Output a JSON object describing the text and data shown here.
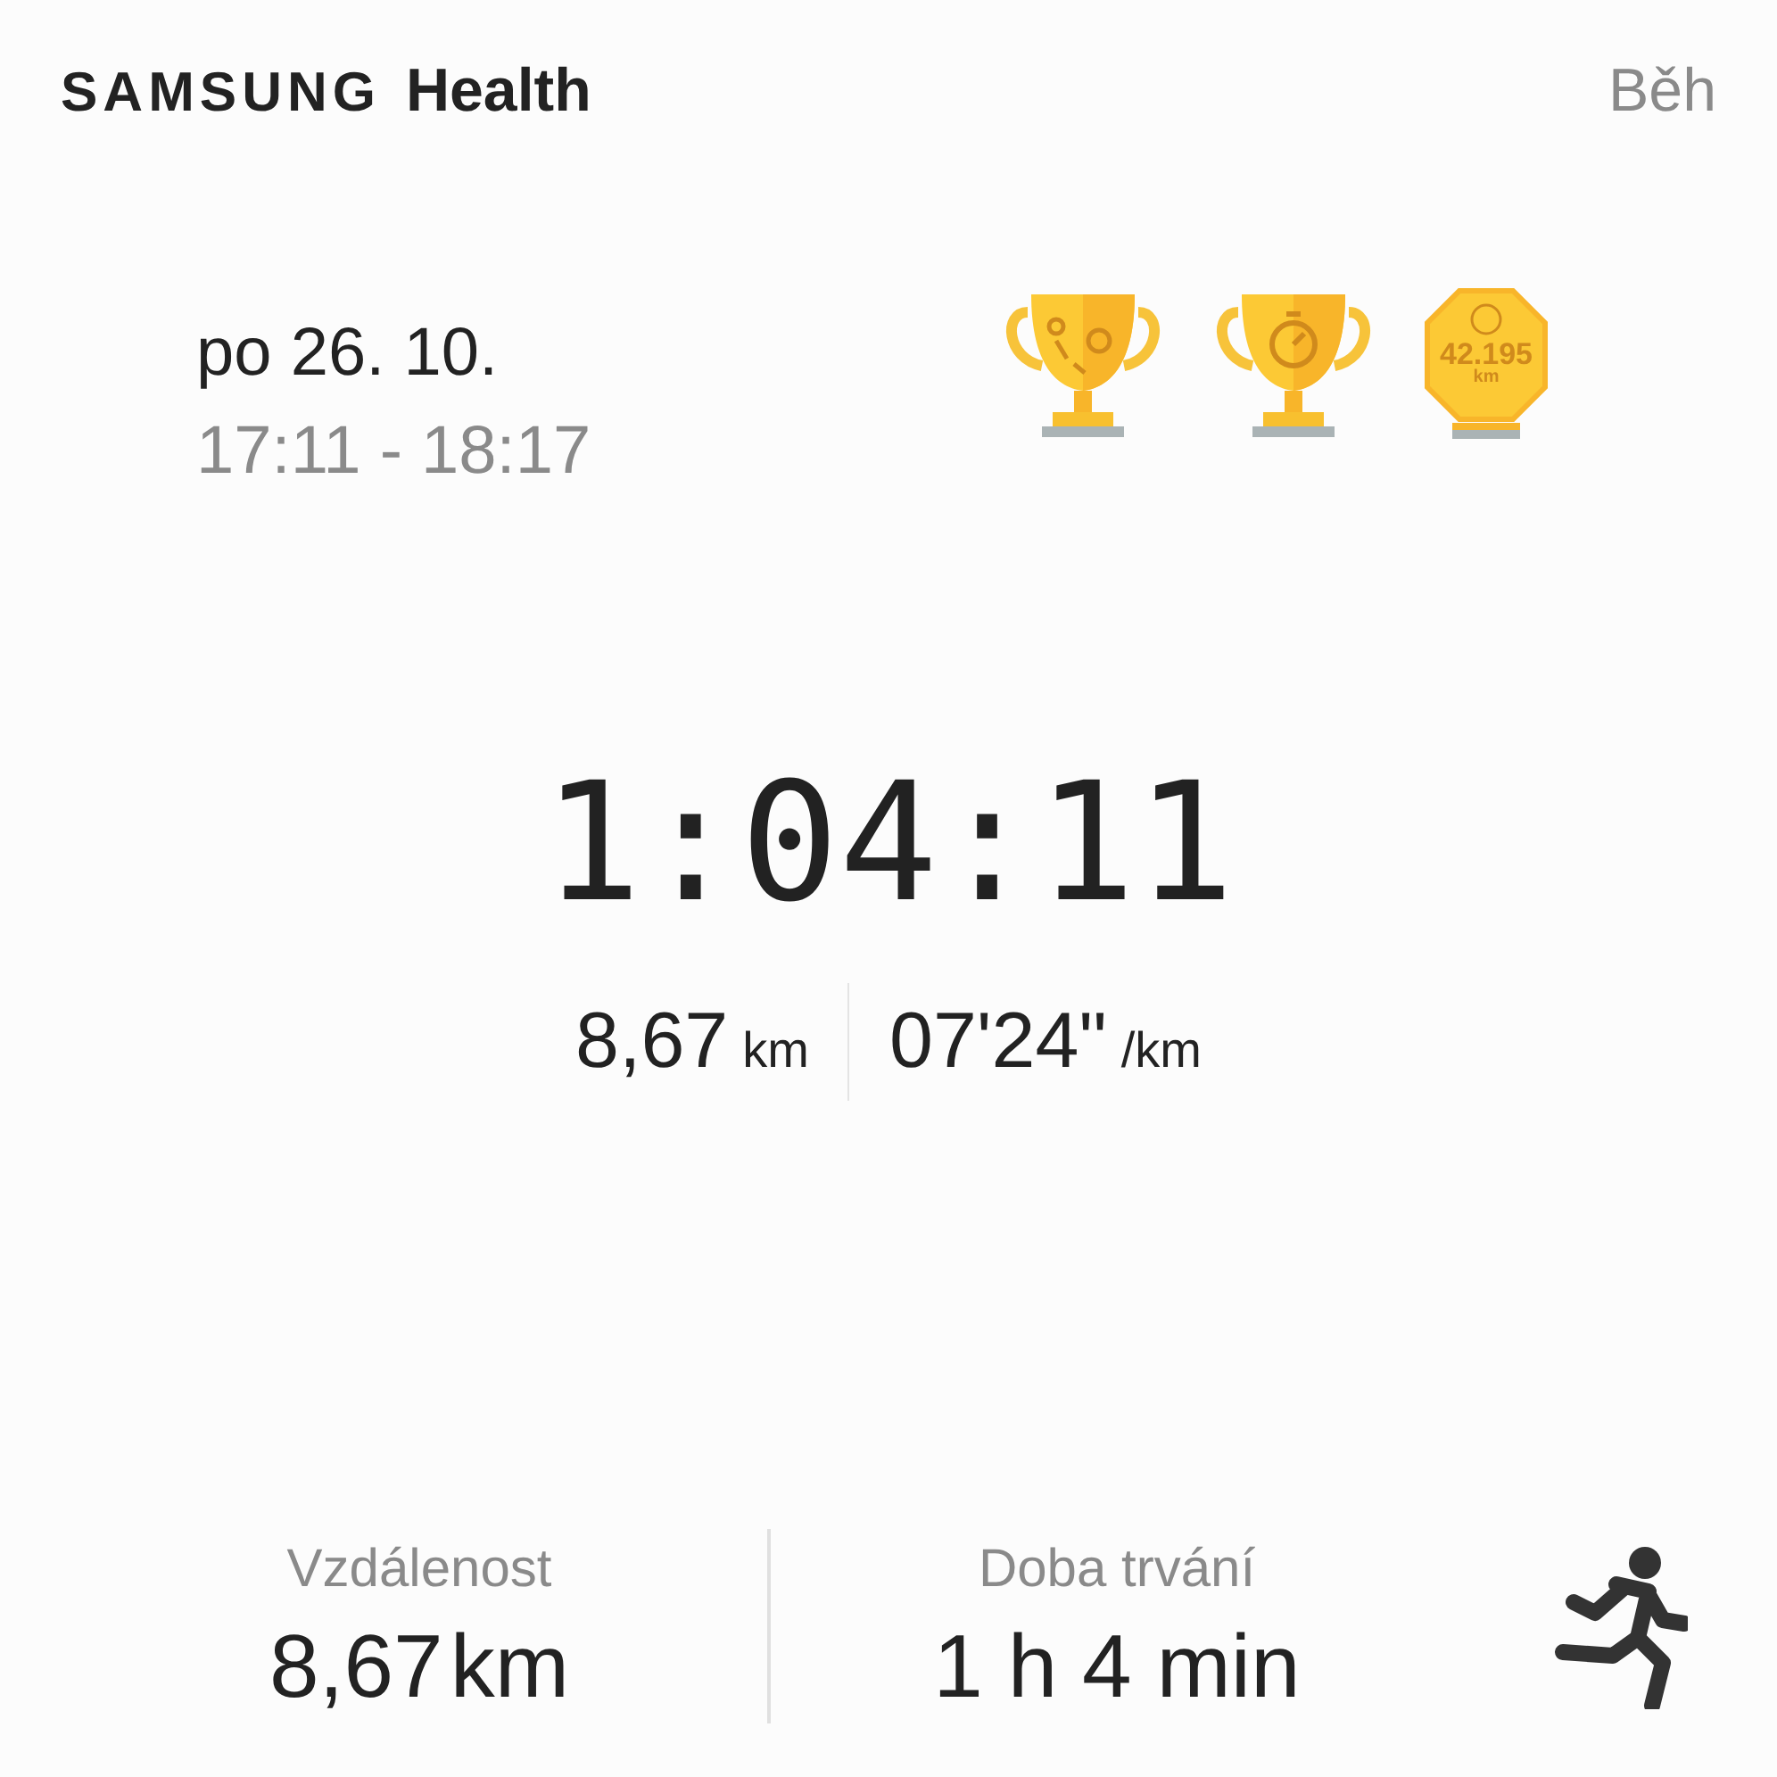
{
  "header": {
    "brand": "SAMSUNG",
    "product": "Health",
    "activity": "Běh"
  },
  "session": {
    "date": "po 26. 10.",
    "time_range": "17:11 - 18:17"
  },
  "badges": [
    {
      "kind": "route"
    },
    {
      "kind": "stopwatch"
    },
    {
      "kind": "distance",
      "value": "42.195",
      "unit": "km"
    }
  ],
  "timer": "1:04:11",
  "summary": [
    {
      "value": "8,67",
      "unit": "km"
    },
    {
      "value": "07'24\"",
      "unit": "/km"
    }
  ],
  "stats": [
    {
      "label": "Vzdálenost",
      "value": "8,67",
      "unit": "km"
    },
    {
      "label": "Doba trvání",
      "value": "1 h 4 min"
    }
  ]
}
